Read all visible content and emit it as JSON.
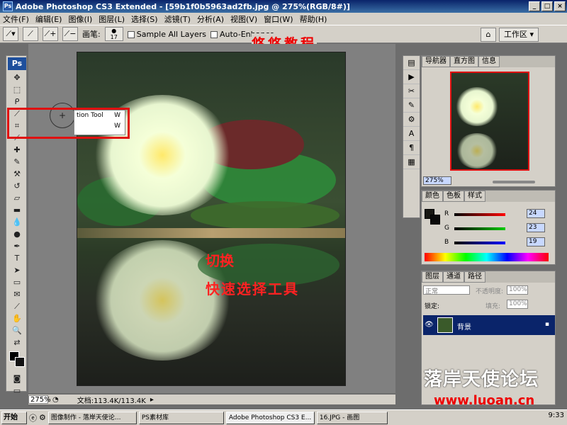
{
  "window": {
    "title": "Adobe Photoshop CS3 Extended - [59b1f0b5963ad2fb.jpg @ 275%(RGB/8#)]"
  },
  "menu": [
    "文件(F)",
    "编辑(E)",
    "图像(I)",
    "图层(L)",
    "选择(S)",
    "滤镜(T)",
    "分析(A)",
    "视图(V)",
    "窗口(W)",
    "帮助(H)"
  ],
  "options": {
    "brush_label": "画笔:",
    "brush_size": "17",
    "sample_all_layers": "Sample All Layers",
    "auto_enhance": "Auto-Enhance",
    "workspace": "工作区 ▾"
  },
  "overlay": {
    "top_caption": "悠悠教程",
    "caption_line1": "切换",
    "caption_line2": "快速选择工具"
  },
  "flyout": {
    "item1": "tion Tool",
    "key1": "W",
    "key2": "W"
  },
  "canvas_status": {
    "zoom": "275%",
    "doc": "文档:113.4K/113.4K"
  },
  "navigator": {
    "tabs": [
      "导航器",
      "直方图",
      "信息"
    ],
    "zoom": "275%"
  },
  "color_panel": {
    "tabs": [
      "颜色",
      "色板",
      "样式"
    ],
    "r_label": "R",
    "g_label": "G",
    "b_label": "B",
    "r": "24",
    "g": "23",
    "b": "19"
  },
  "layers_panel": {
    "tabs": [
      "图层",
      "通道",
      "路径"
    ],
    "blend_mode": "正常",
    "opacity_label": "不透明度:",
    "opacity": "100%",
    "lock_label": "锁定:",
    "fill_label": "填充:",
    "fill": "100%",
    "layer_name": "背景"
  },
  "taskbar": {
    "start": "开始",
    "tasks": [
      "图像制作 - 落岸天使论...",
      "PS素材库",
      "Adobe Photoshop CS3 E...",
      "16.JPG - 画图"
    ],
    "clock": "9:33"
  },
  "watermark": {
    "text": "落岸天使论坛",
    "url": "www.luoan.cn"
  }
}
